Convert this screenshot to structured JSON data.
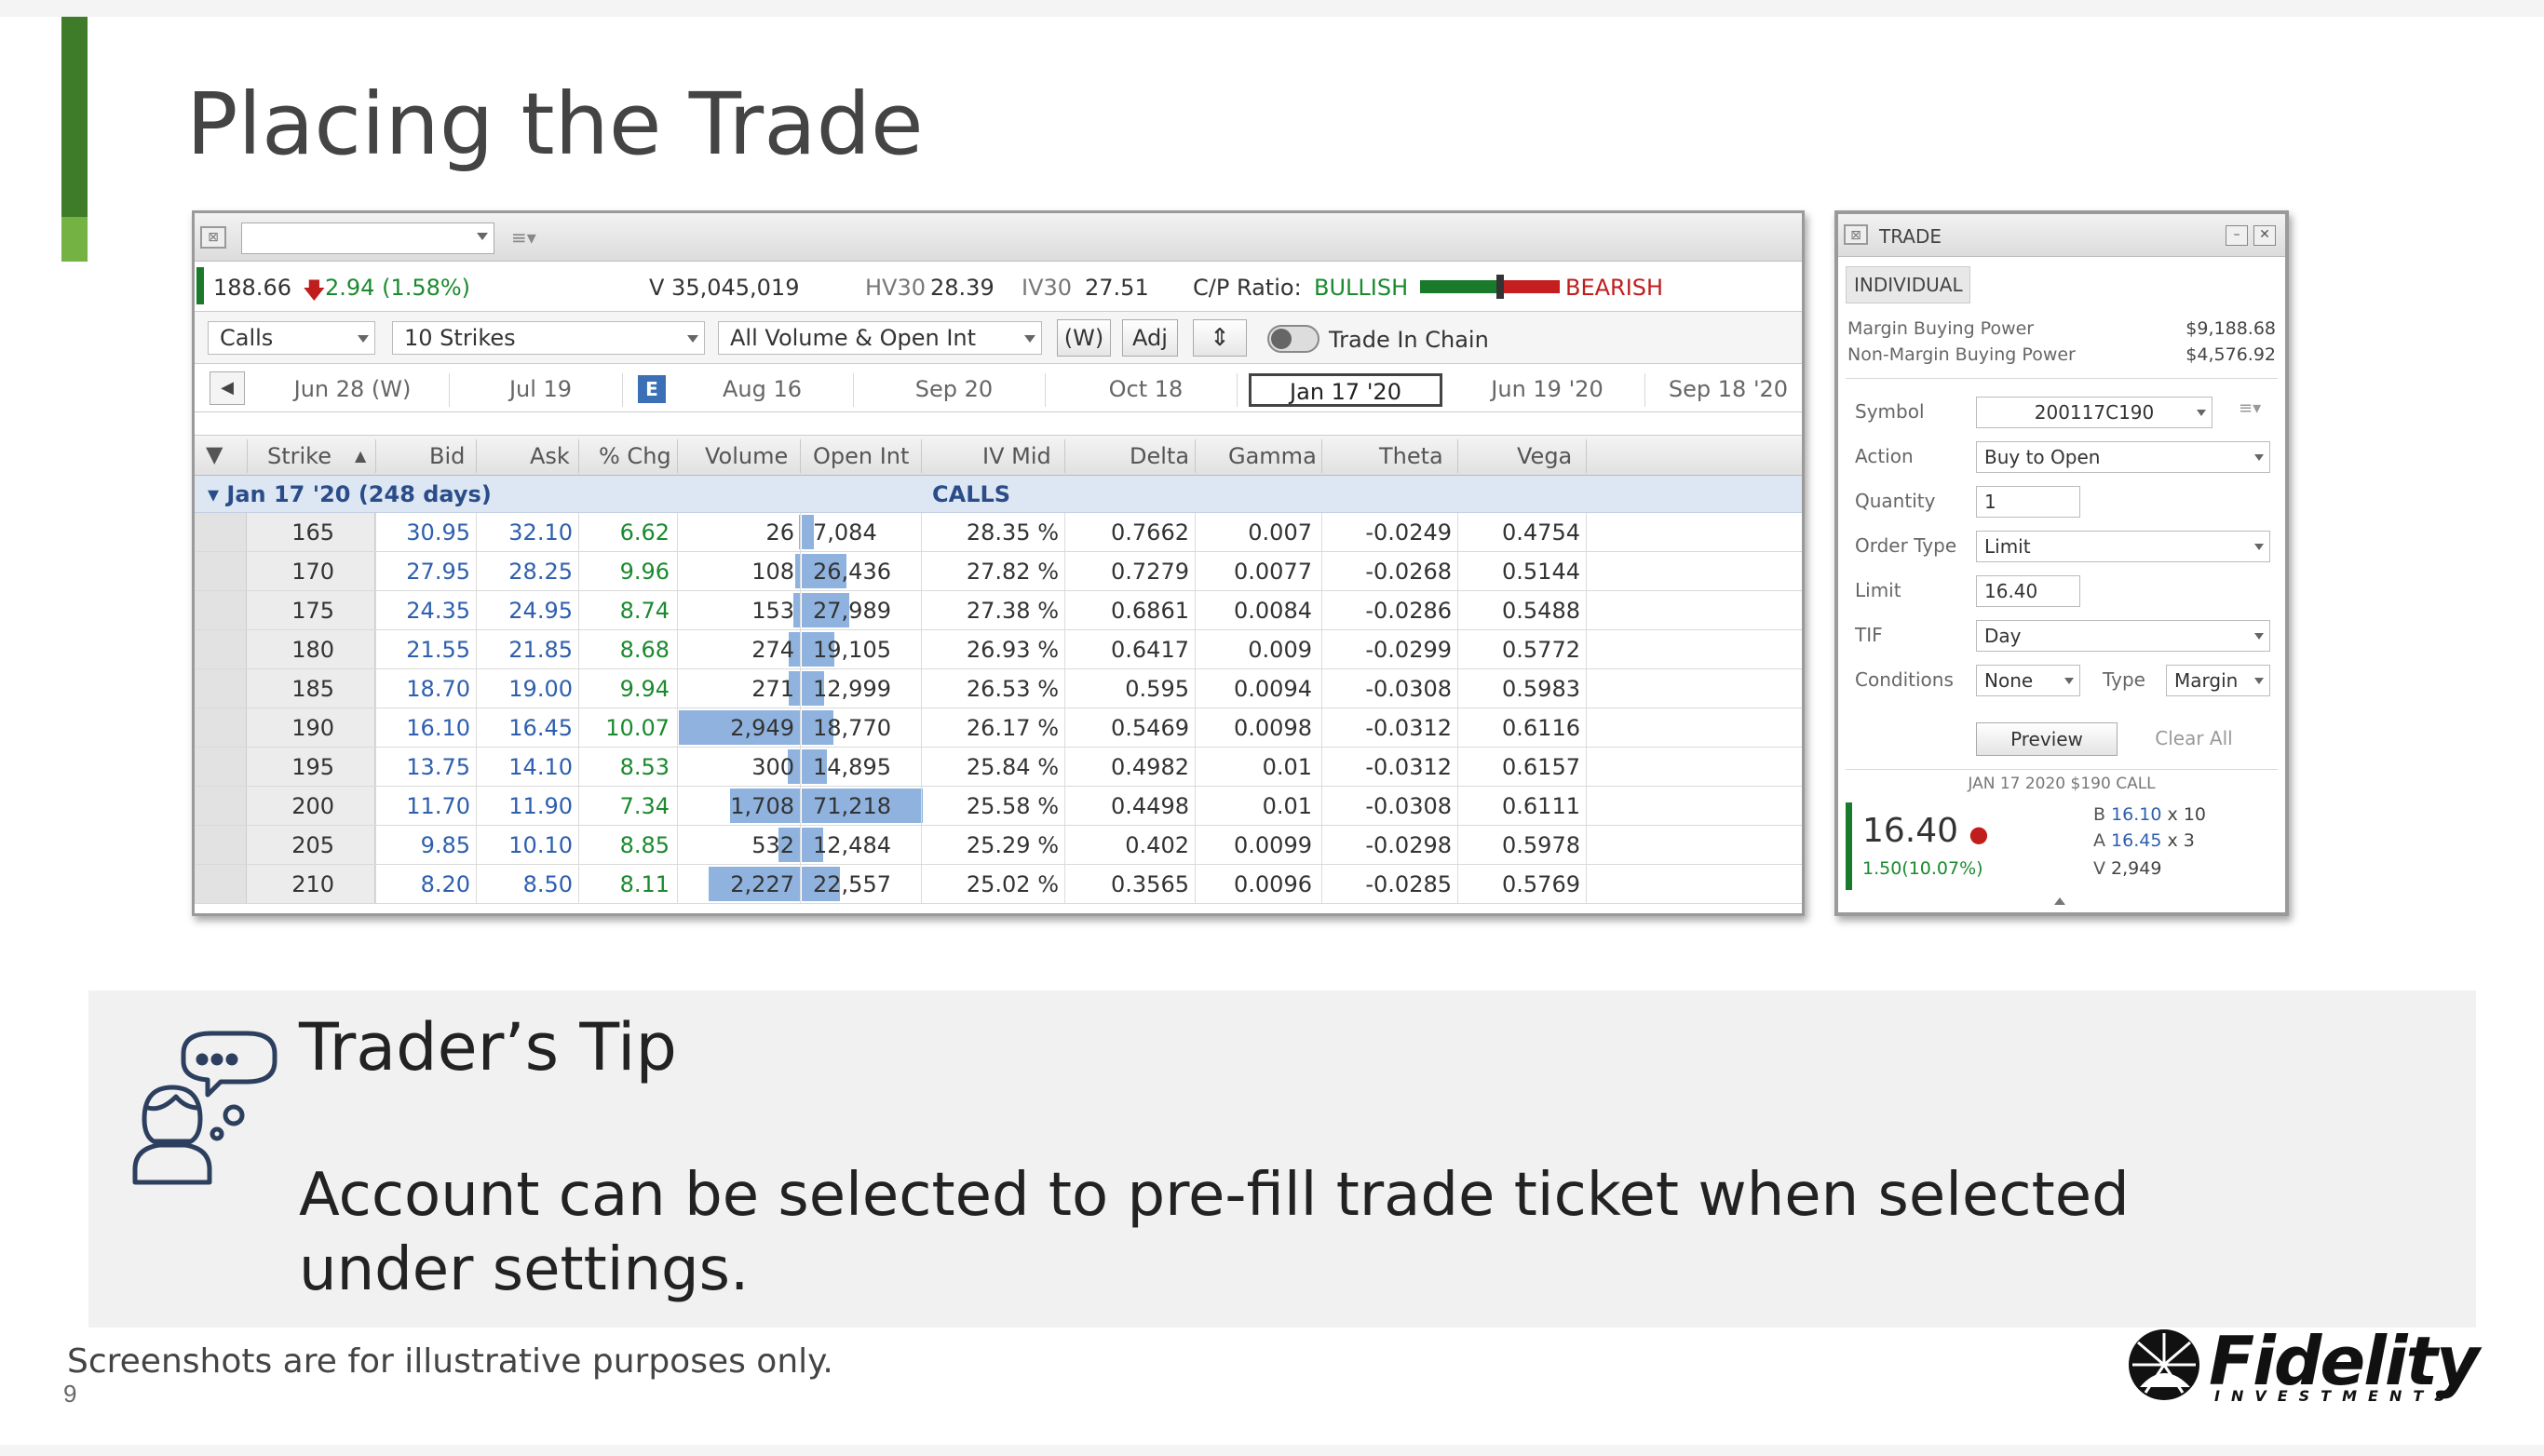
{
  "slide": {
    "title": "Placing the Trade",
    "footnote": "Screenshots are for illustrative purposes only.",
    "page_number": "9",
    "accent_colors": {
      "dark": "#3f7c2a",
      "light": "#73b243"
    }
  },
  "chain": {
    "quote": {
      "last": "188.66",
      "change": "2.94 (1.58%)",
      "volume": "V 35,045,019",
      "hv30_label": "HV30",
      "hv30": "28.39",
      "iv30_label": "IV30",
      "iv30": "27.51",
      "cp_ratio_label": "C/P Ratio:",
      "bullish": "BULLISH",
      "bearish": "BEARISH"
    },
    "filters": {
      "type": "Calls",
      "strikes": "10 Strikes",
      "volume_filter": "All Volume & Open Int",
      "weekly_btn": "(W)",
      "adj_btn": "Adj",
      "trade_in_chain": "Trade In Chain"
    },
    "expirations": [
      "Jun 28 (W)",
      "Jul 19",
      "Aug 16",
      "Sep 20",
      "Oct 18",
      "Jan 17 '20",
      "Jun 19 '20",
      "Sep 18 '20"
    ],
    "earnings_badge": "E",
    "headers": [
      "Strike",
      "Bid",
      "Ask",
      "% Chg",
      "Volume",
      "Open Int",
      "IV Mid",
      "Delta",
      "Gamma",
      "Theta",
      "Vega"
    ],
    "group_label": "Jan 17 '20 (248 days)",
    "calls_label": "CALLS",
    "rows": [
      {
        "strike": "165",
        "bid": "30.95",
        "ask": "32.10",
        "chg": "6.62",
        "volume": "26",
        "oi": "7,084",
        "iv": "28.35 %",
        "delta": "0.7662",
        "gamma": "0.007",
        "theta": "-0.0249",
        "vega": "0.4754"
      },
      {
        "strike": "170",
        "bid": "27.95",
        "ask": "28.25",
        "chg": "9.96",
        "volume": "108",
        "oi": "26,436",
        "iv": "27.82 %",
        "delta": "0.7279",
        "gamma": "0.0077",
        "theta": "-0.0268",
        "vega": "0.5144"
      },
      {
        "strike": "175",
        "bid": "24.35",
        "ask": "24.95",
        "chg": "8.74",
        "volume": "153",
        "oi": "27,989",
        "iv": "27.38 %",
        "delta": "0.6861",
        "gamma": "0.0084",
        "theta": "-0.0286",
        "vega": "0.5488"
      },
      {
        "strike": "180",
        "bid": "21.55",
        "ask": "21.85",
        "chg": "8.68",
        "volume": "274",
        "oi": "19,105",
        "iv": "26.93 %",
        "delta": "0.6417",
        "gamma": "0.009",
        "theta": "-0.0299",
        "vega": "0.5772"
      },
      {
        "strike": "185",
        "bid": "18.70",
        "ask": "19.00",
        "chg": "9.94",
        "volume": "271",
        "oi": "12,999",
        "iv": "26.53 %",
        "delta": "0.595",
        "gamma": "0.0094",
        "theta": "-0.0308",
        "vega": "0.5983"
      },
      {
        "strike": "190",
        "bid": "16.10",
        "ask": "16.45",
        "chg": "10.07",
        "volume": "2,949",
        "oi": "18,770",
        "iv": "26.17 %",
        "delta": "0.5469",
        "gamma": "0.0098",
        "theta": "-0.0312",
        "vega": "0.6116"
      },
      {
        "strike": "195",
        "bid": "13.75",
        "ask": "14.10",
        "chg": "8.53",
        "volume": "300",
        "oi": "14,895",
        "iv": "25.84 %",
        "delta": "0.4982",
        "gamma": "0.01",
        "theta": "-0.0312",
        "vega": "0.6157"
      },
      {
        "strike": "200",
        "bid": "11.70",
        "ask": "11.90",
        "chg": "7.34",
        "volume": "1,708",
        "oi": "71,218",
        "iv": "25.58 %",
        "delta": "0.4498",
        "gamma": "0.01",
        "theta": "-0.0308",
        "vega": "0.6111"
      },
      {
        "strike": "205",
        "bid": "9.85",
        "ask": "10.10",
        "chg": "8.85",
        "volume": "532",
        "oi": "12,484",
        "iv": "25.29 %",
        "delta": "0.402",
        "gamma": "0.0099",
        "theta": "-0.0298",
        "vega": "0.5978"
      },
      {
        "strike": "210",
        "bid": "8.20",
        "ask": "8.50",
        "chg": "8.11",
        "volume": "2,227",
        "oi": "22,557",
        "iv": "25.02 %",
        "delta": "0.3565",
        "gamma": "0.0096",
        "theta": "-0.0285",
        "vega": "0.5769"
      }
    ]
  },
  "ticket": {
    "title": "TRADE",
    "account_tab": "INDIVIDUAL",
    "margin_bp_label": "Margin Buying Power",
    "margin_bp": "$9,188.68",
    "non_margin_bp_label": "Non-Margin Buying Power",
    "non_margin_bp": "$4,576.92",
    "symbol_label": "Symbol",
    "symbol": "200117C190",
    "action_label": "Action",
    "action": "Buy to Open",
    "quantity_label": "Quantity",
    "quantity": "1",
    "order_type_label": "Order Type",
    "order_type": "Limit",
    "limit_label": "Limit",
    "limit": "16.40",
    "tif_label": "TIF",
    "tif": "Day",
    "conditions_label": "Conditions",
    "conditions": "None",
    "type_label": "Type",
    "type": "Margin",
    "preview_btn": "Preview",
    "clear_btn": "Clear All",
    "contract": "JAN 17 2020 $190 CALL",
    "last": "16.40",
    "change": "1.50(10.07%)",
    "bid_label": "B",
    "bid": "16.10",
    "bid_size": "x 10",
    "ask_label": "A",
    "ask": "16.45",
    "ask_size": "x 3",
    "vol_label": "V",
    "vol": "2,949"
  },
  "tip": {
    "heading": "Trader’s Tip",
    "body": "Account can be selected to pre-fill trade ticket when selected under settings."
  },
  "logo": {
    "word": "Fidelity",
    "sub": "INVESTMENTS"
  }
}
